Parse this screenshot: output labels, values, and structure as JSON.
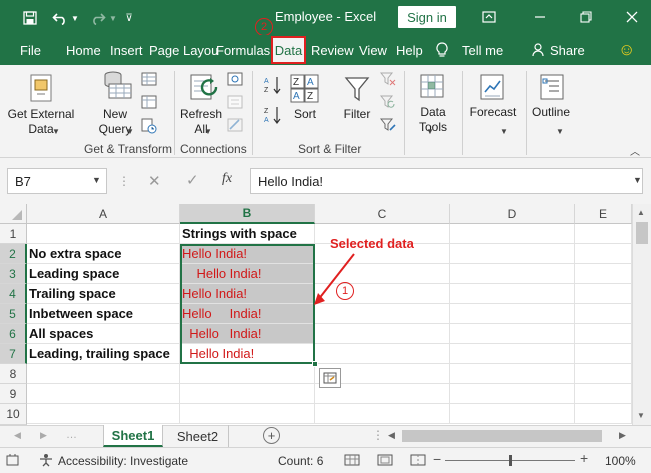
{
  "window": {
    "title": "Employee  -  Excel",
    "signin_label": "Sign in",
    "accent": "#217346"
  },
  "tabs": [
    {
      "label": "File"
    },
    {
      "label": "Home"
    },
    {
      "label": "Insert"
    },
    {
      "label": "Page Layou"
    },
    {
      "label": "Formulas"
    },
    {
      "label": "Data",
      "active": true
    },
    {
      "label": "Review"
    },
    {
      "label": "View"
    },
    {
      "label": "Help"
    },
    {
      "label": "Tell me"
    },
    {
      "label": "Share"
    }
  ],
  "ribbon": {
    "get_external_data": "Get External\nData",
    "new_query": "New\nQuery",
    "refresh_all": "Refresh\nAll",
    "sort": "Sort",
    "filter": "Filter",
    "data_tools": "Data\nTools",
    "forecast": "Forecast",
    "outline": "Outline",
    "groups": {
      "get_transform": "Get & Transform",
      "connections": "Connections",
      "sort_filter": "Sort & Filter"
    }
  },
  "formula_bar": {
    "name_box": "B7",
    "fx": "fx",
    "value": "Hello India!"
  },
  "columns": [
    "A",
    "B",
    "C",
    "D",
    "E"
  ],
  "rows": [
    "1",
    "2",
    "3",
    "4",
    "5",
    "6",
    "7",
    "8",
    "9",
    "10"
  ],
  "cells": {
    "B1": "Strings with space",
    "A2": "No extra space",
    "A3": "Leading space",
    "A4": "Trailing space",
    "A5": "Inbetween space",
    "A6": "All spaces",
    "A7": "Leading, trailing space",
    "B2": "Hello India!",
    "B3": "    Hello India!",
    "B4": "Hello India!",
    "B5": "Hello     India!",
    "B6": "  Hello   India!",
    "B7": "  Hello India!"
  },
  "annotations": {
    "selected_data": "Selected data",
    "step1": "1",
    "step2": "2"
  },
  "sheets": [
    {
      "label": "Sheet1",
      "active": true
    },
    {
      "label": "Sheet2",
      "active": false
    }
  ],
  "status": {
    "accessibility": "Accessibility: Investigate",
    "count": "Count: 6",
    "zoom": "100%"
  }
}
